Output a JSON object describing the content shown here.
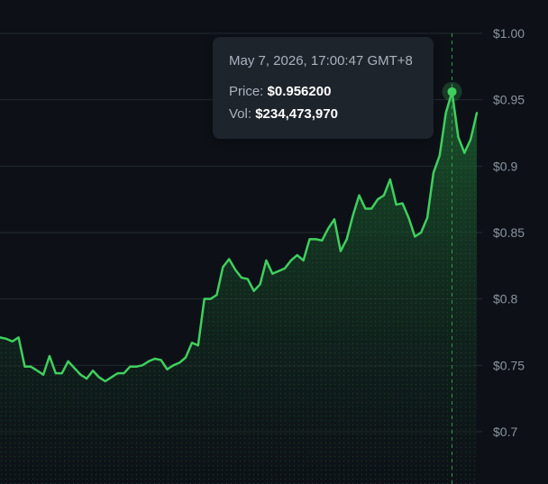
{
  "chart_data": {
    "type": "area",
    "title": "",
    "xlabel": "",
    "ylabel": "",
    "ylim": [
      0.68,
      1.0
    ],
    "y_ticks": [
      "$1.00",
      "$0.95",
      "$0.9",
      "$0.85",
      "$0.8",
      "$0.75",
      "$0.7"
    ],
    "y_tick_values": [
      1.0,
      0.95,
      0.9,
      0.85,
      0.8,
      0.75,
      0.7
    ],
    "grid": true,
    "y_axis_position": "right",
    "series": [
      {
        "values": [
          0.771,
          0.77,
          0.768,
          0.771,
          0.749,
          0.749,
          0.746,
          0.743,
          0.757,
          0.744,
          0.744,
          0.753,
          0.748,
          0.743,
          0.74,
          0.746,
          0.741,
          0.738,
          0.741,
          0.744,
          0.744,
          0.749,
          0.749,
          0.75,
          0.753,
          0.755,
          0.754,
          0.747,
          0.75,
          0.752,
          0.756,
          0.767,
          0.765,
          0.8,
          0.8,
          0.803,
          0.824,
          0.83,
          0.822,
          0.816,
          0.815,
          0.806,
          0.811,
          0.829,
          0.819,
          0.821,
          0.823,
          0.829,
          0.833,
          0.829,
          0.845,
          0.845,
          0.844,
          0.853,
          0.86,
          0.836,
          0.845,
          0.863,
          0.878,
          0.868,
          0.868,
          0.875,
          0.878,
          0.89,
          0.871,
          0.872,
          0.861,
          0.847,
          0.85,
          0.861,
          0.895,
          0.908,
          0.94,
          0.956,
          0.922,
          0.91,
          0.92,
          0.94
        ]
      }
    ],
    "highlight_index": 73,
    "colors": {
      "background": "#0d1117",
      "line": "#3fcf5e",
      "fill": "#1f6b32",
      "grid": "#232a31",
      "crosshair": "#2f9e4b",
      "axis_text": "#8b949e"
    }
  },
  "tooltip": {
    "date": "May 7, 2026, 17:00:47 GMT+8",
    "price_label": "Price:",
    "price_value": "$0.956200",
    "vol_label": "Vol:",
    "vol_value": "$234,473,970"
  }
}
